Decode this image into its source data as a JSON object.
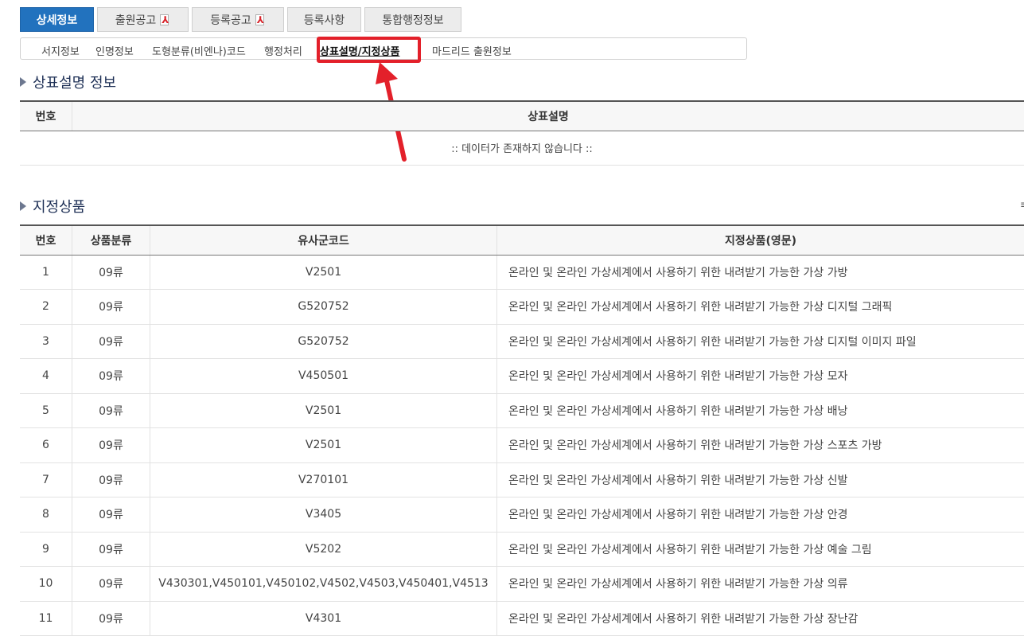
{
  "tabs": [
    {
      "label": "상세정보",
      "active": true,
      "pdf": false
    },
    {
      "label": "출원공고",
      "active": false,
      "pdf": true
    },
    {
      "label": "등록공고",
      "active": false,
      "pdf": true
    },
    {
      "label": "등록사항",
      "active": false,
      "pdf": false
    },
    {
      "label": "통합행정정보",
      "active": false,
      "pdf": false
    }
  ],
  "submenu": [
    {
      "label": "서지정보",
      "current": false
    },
    {
      "label": "인명정보",
      "current": false
    },
    {
      "label": "도형분류(비엔나)코드",
      "current": false
    },
    {
      "label": "행정처리",
      "current": false
    },
    {
      "label": "상표설명/지정상품",
      "current": true
    },
    {
      "label": "마드리드 출원정보",
      "current": false
    }
  ],
  "description_section": {
    "title": "상표설명 정보",
    "columns": [
      "번호",
      "상표설명"
    ],
    "empty_message": ":: 데이터가 존재하지 않습니다 ::"
  },
  "goods_section": {
    "title": "지정상품",
    "side_mark": "≡",
    "columns": [
      "번호",
      "상품분류",
      "유사군코드",
      "지정상품(영문)"
    ],
    "rows": [
      [
        "1",
        "09류",
        "V2501",
        "온라인 및 온라인 가상세계에서 사용하기 위한 내려받기 가능한 가상 가방"
      ],
      [
        "2",
        "09류",
        "G520752",
        "온라인 및 온라인 가상세계에서 사용하기 위한 내려받기 가능한 가상 디지털 그래픽"
      ],
      [
        "3",
        "09류",
        "G520752",
        "온라인 및 온라인 가상세계에서 사용하기 위한 내려받기 가능한 가상 디지털 이미지 파일"
      ],
      [
        "4",
        "09류",
        "V450501",
        "온라인 및 온라인 가상세계에서 사용하기 위한 내려받기 가능한 가상 모자"
      ],
      [
        "5",
        "09류",
        "V2501",
        "온라인 및 온라인 가상세계에서 사용하기 위한 내려받기 가능한 가상 배낭"
      ],
      [
        "6",
        "09류",
        "V2501",
        "온라인 및 온라인 가상세계에서 사용하기 위한 내려받기 가능한 가상 스포츠 가방"
      ],
      [
        "7",
        "09류",
        "V270101",
        "온라인 및 온라인 가상세계에서 사용하기 위한 내려받기 가능한 가상 신발"
      ],
      [
        "8",
        "09류",
        "V3405",
        "온라인 및 온라인 가상세계에서 사용하기 위한 내려받기 가능한 가상 안경"
      ],
      [
        "9",
        "09류",
        "V5202",
        "온라인 및 온라인 가상세계에서 사용하기 위한 내려받기 가능한 가상 예술 그림"
      ],
      [
        "10",
        "09류",
        "V430301,V450101,V450102,V4502,V4503,V450401,V4513",
        "온라인 및 온라인 가상세계에서 사용하기 위한 내려받기 가능한 가상 의류"
      ],
      [
        "11",
        "09류",
        "V4301",
        "온라인 및 온라인 가상세계에서 사용하기 위한 내려받기 가능한 가상 장난감"
      ]
    ]
  },
  "colors": {
    "active_tab": "#2272be",
    "highlight": "#e3202a",
    "title": "#1d2f55"
  }
}
